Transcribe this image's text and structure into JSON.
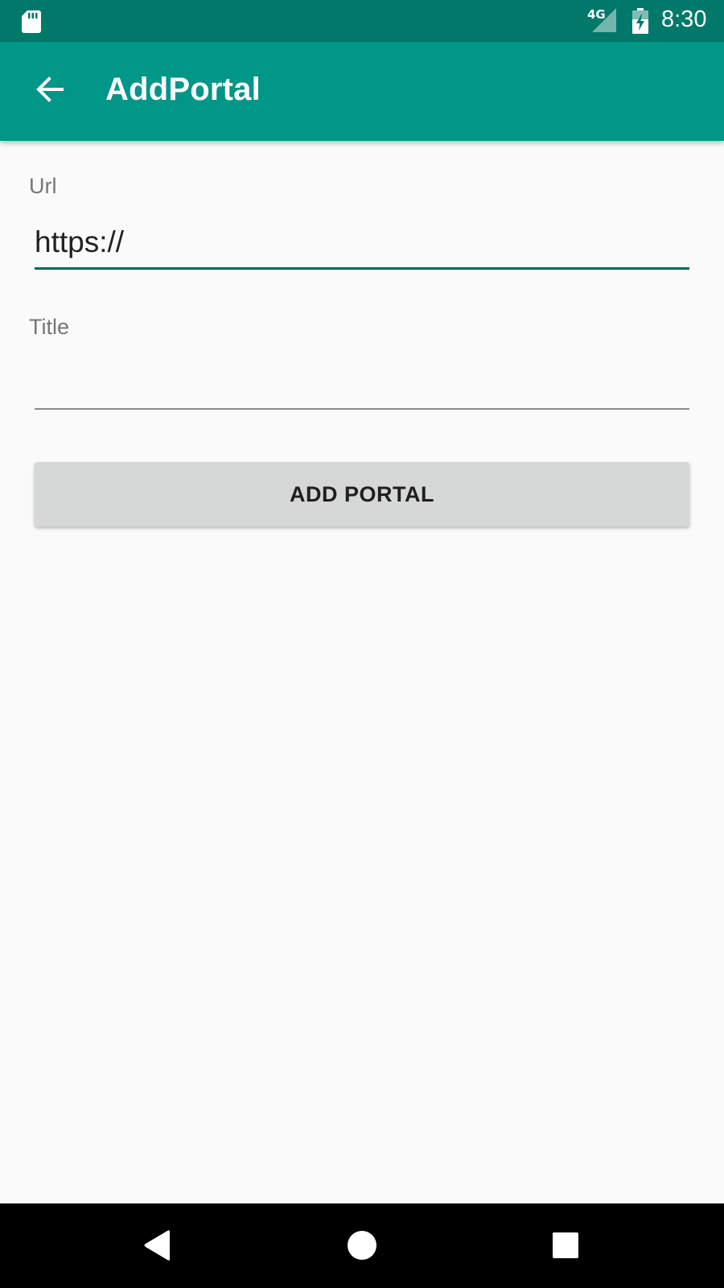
{
  "status_bar": {
    "network": "4G",
    "time": "8:30",
    "icons": [
      "sd-card-icon",
      "signal-icon",
      "battery-charging-icon"
    ]
  },
  "app_bar": {
    "title": "AddPortal",
    "back_icon": "arrow-back-icon"
  },
  "form": {
    "url": {
      "label": "Url",
      "value": "https://"
    },
    "title": {
      "label": "Title",
      "value": ""
    },
    "submit_label": "ADD PORTAL"
  },
  "nav_bar": {
    "icons": [
      "nav-back-icon",
      "nav-home-icon",
      "nav-recents-icon"
    ]
  },
  "colors": {
    "status_bar": "#00796b",
    "app_bar": "#009688",
    "accent_underline": "#00695c",
    "button": "#d6d7d7",
    "background": "#fafafa"
  }
}
